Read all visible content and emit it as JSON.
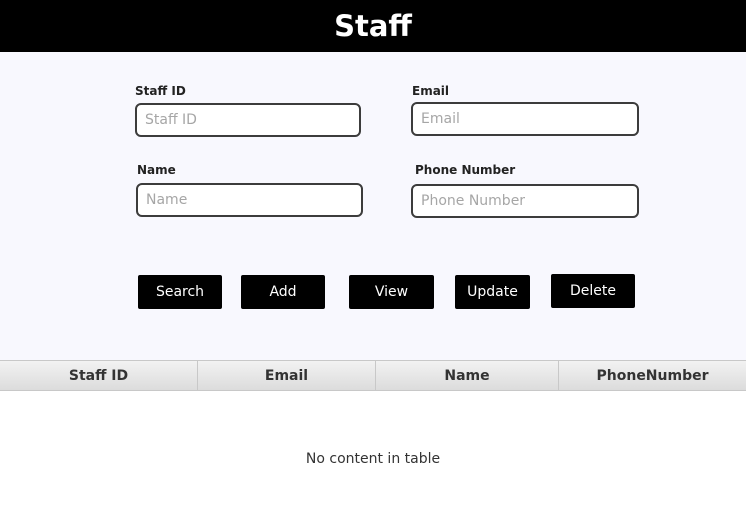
{
  "header": {
    "title": "Staff"
  },
  "form": {
    "staff_id": {
      "label": "Staff ID",
      "placeholder": "Staff ID",
      "value": ""
    },
    "email": {
      "label": "Email",
      "placeholder": "Email",
      "value": ""
    },
    "name": {
      "label": "Name",
      "placeholder": "Name",
      "value": ""
    },
    "phone": {
      "label": "Phone Number",
      "placeholder": "Phone Number",
      "value": ""
    }
  },
  "buttons": {
    "search": "Search",
    "add": "Add",
    "view": "View",
    "update": "Update",
    "delete": "Delete"
  },
  "table": {
    "columns": [
      "Staff ID",
      "Email",
      "Name",
      "PhoneNumber"
    ],
    "rows": [],
    "empty_message": "No content in table"
  },
  "colors": {
    "header_bg": "#000000",
    "form_bg": "#f8f8fe",
    "button_bg": "#000000",
    "button_text": "#ffffff"
  }
}
